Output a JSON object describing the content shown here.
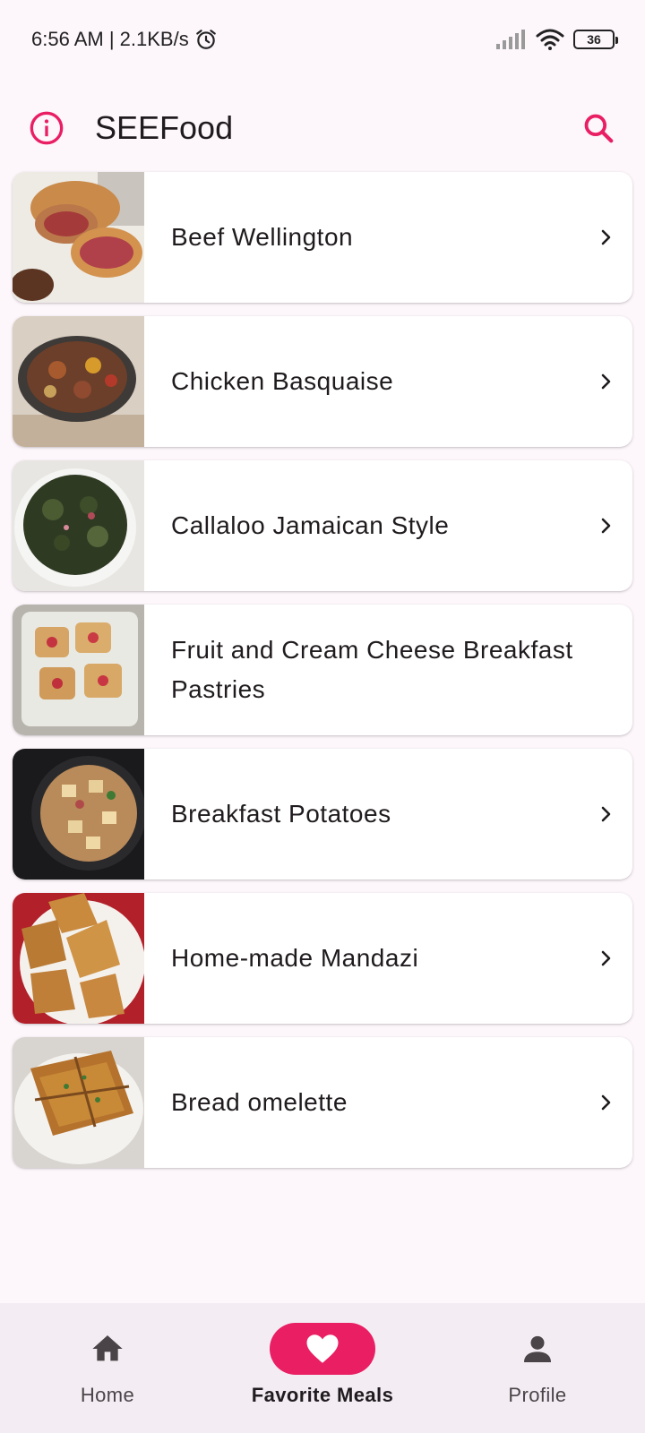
{
  "status_bar": {
    "time_speed": "6:56 AM | 2.1KB/s",
    "battery": "36"
  },
  "app_bar": {
    "title": "SEEFood"
  },
  "meals": [
    {
      "name": "Beef Wellington",
      "has_chevron": true
    },
    {
      "name": "Chicken Basquaise",
      "has_chevron": true
    },
    {
      "name": "Callaloo Jamaican Style",
      "has_chevron": true
    },
    {
      "name": "Fruit and Cream Cheese Breakfast Pastries",
      "has_chevron": false
    },
    {
      "name": "Breakfast Potatoes",
      "has_chevron": true
    },
    {
      "name": "Home-made Mandazi",
      "has_chevron": true
    },
    {
      "name": "Bread omelette",
      "has_chevron": true
    }
  ],
  "bottom_nav": {
    "items": [
      {
        "label": "Home",
        "icon": "home-icon",
        "active": false
      },
      {
        "label": "Favorite Meals",
        "icon": "heart-icon",
        "active": true
      },
      {
        "label": "Profile",
        "icon": "person-icon",
        "active": false
      }
    ]
  },
  "colors": {
    "accent": "#e91e63",
    "background": "#fdf6fb",
    "nav_background": "#f3edf3"
  }
}
